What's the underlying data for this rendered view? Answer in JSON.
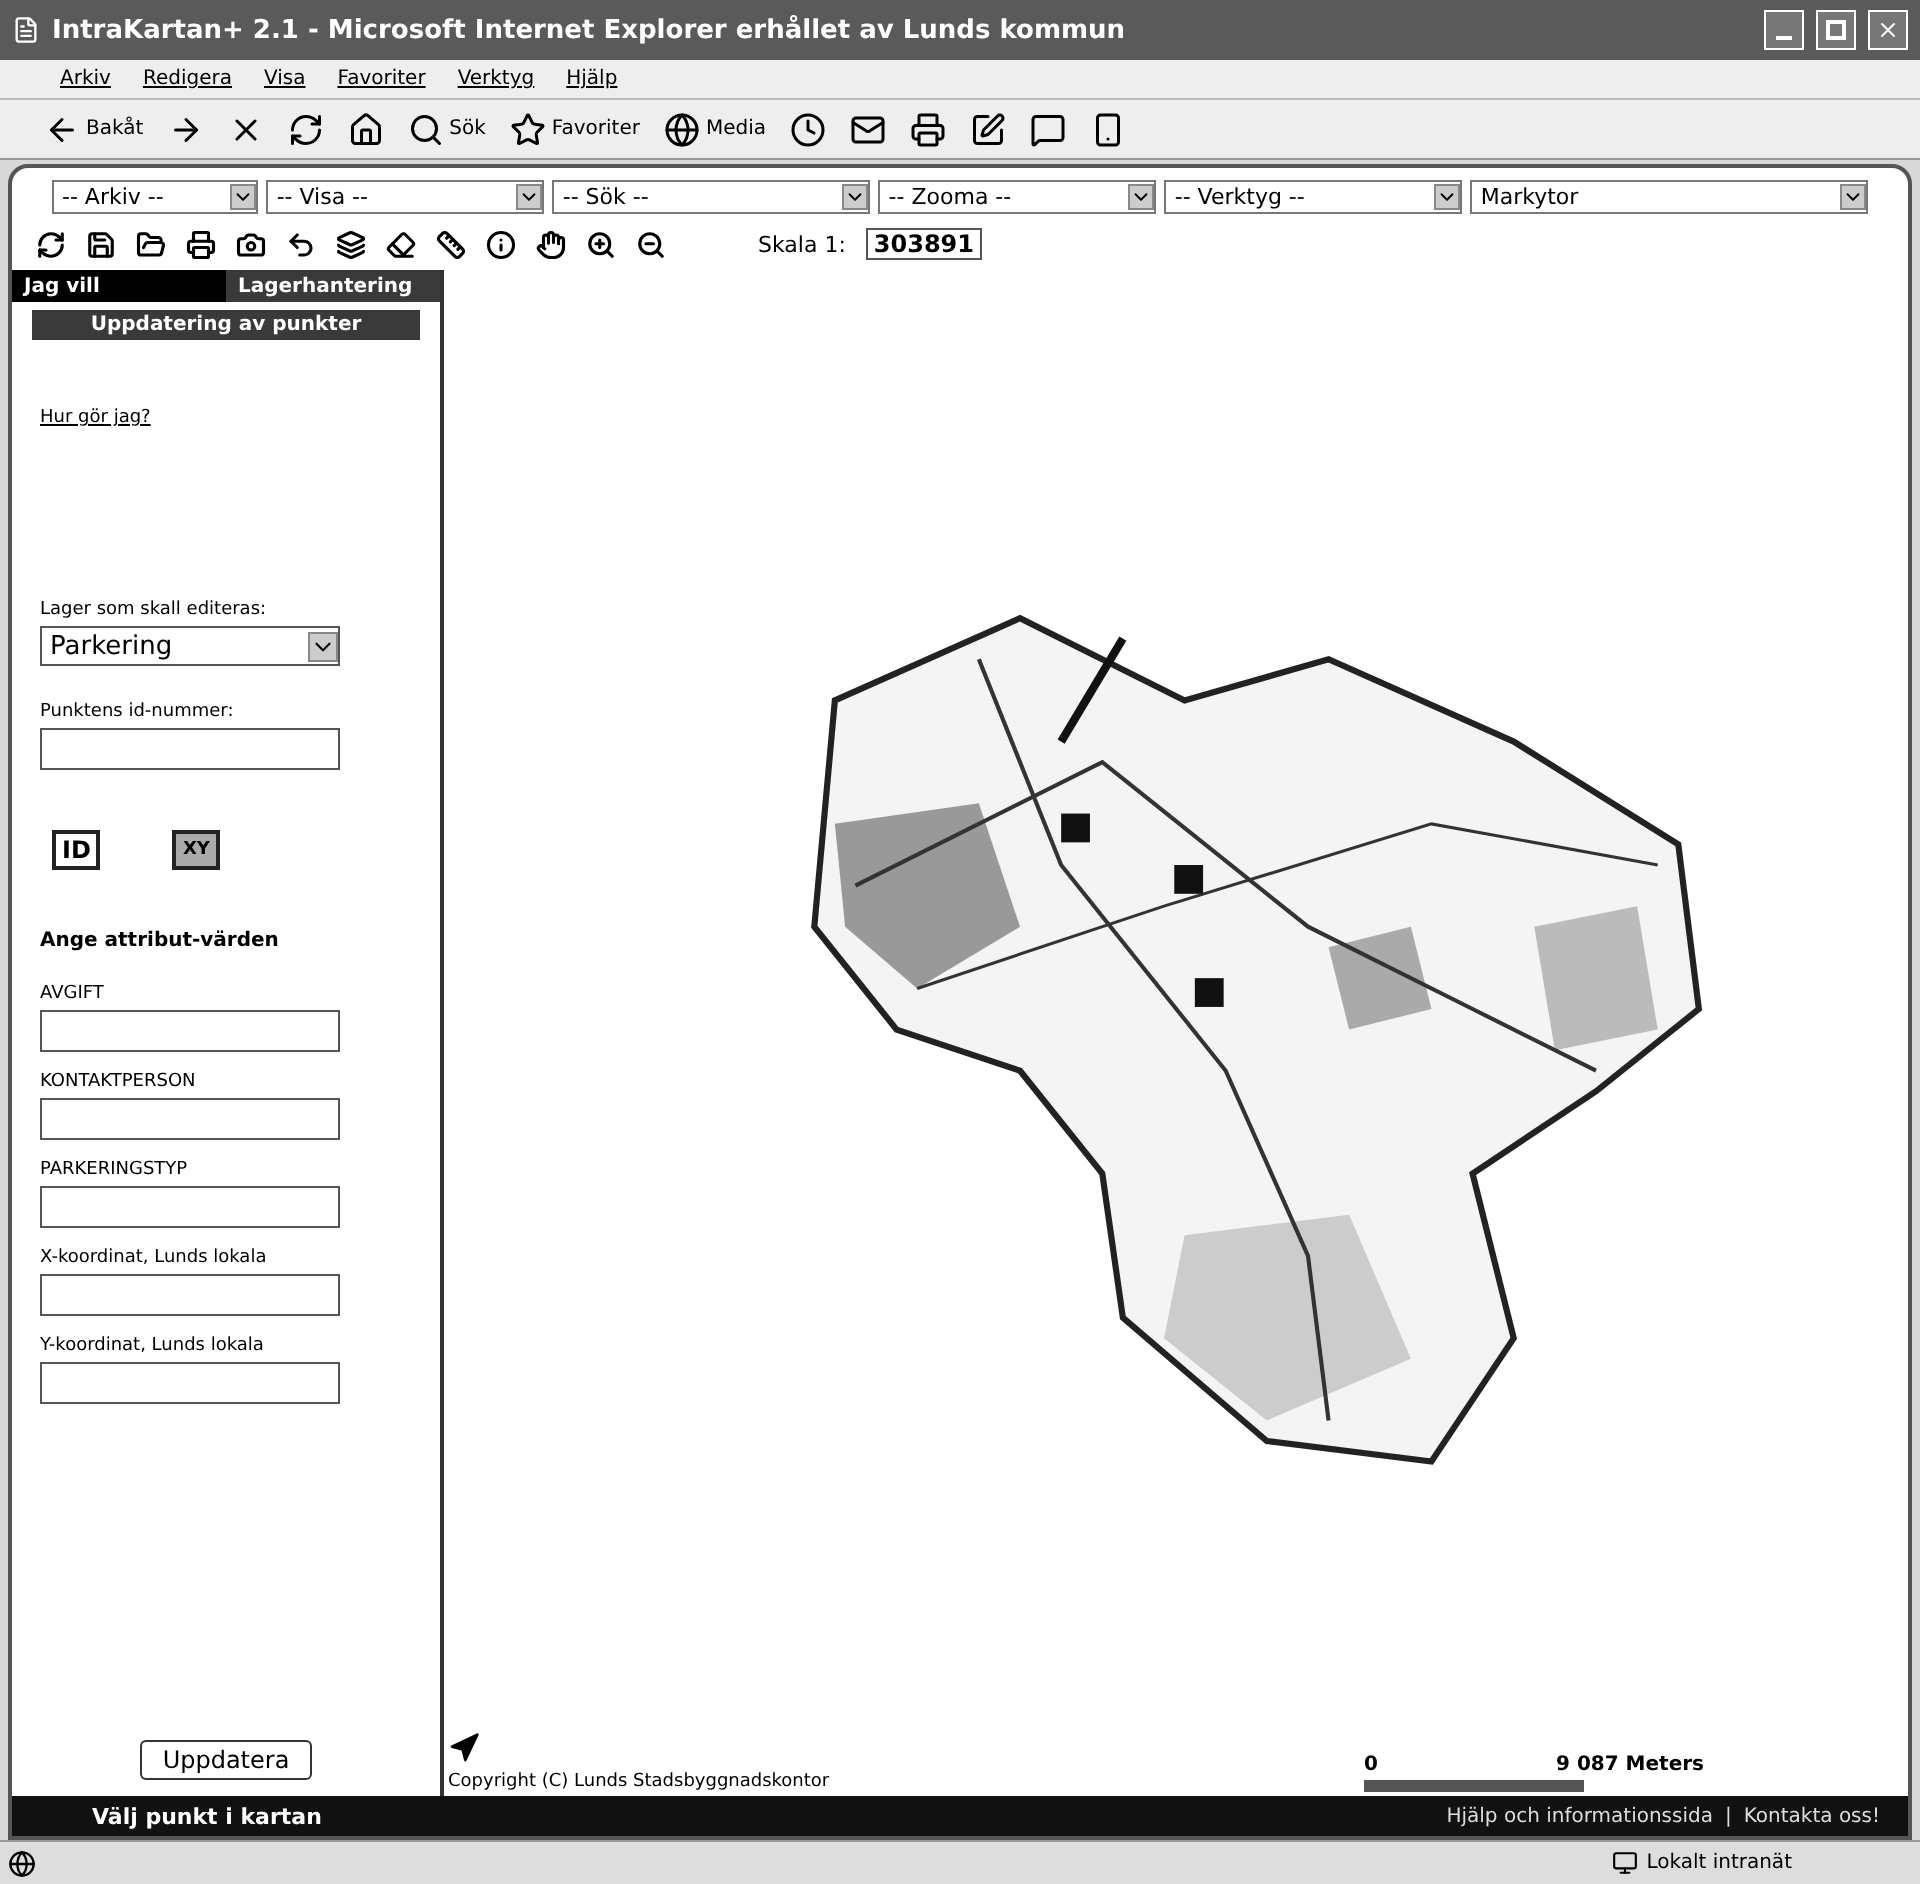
{
  "window": {
    "title": "IntraKartan+ 2.1 - Microsoft Internet Explorer erhållet av Lunds kommun"
  },
  "menu": [
    "Arkiv",
    "Redigera",
    "Visa",
    "Favoriter",
    "Verktyg",
    "Hjälp"
  ],
  "browser_toolbar": [
    {
      "kind": "back",
      "label": "Bakåt"
    },
    {
      "kind": "forward"
    },
    {
      "kind": "stop"
    },
    {
      "kind": "refresh"
    },
    {
      "kind": "home"
    },
    {
      "kind": "search",
      "label": "Sök"
    },
    {
      "kind": "favorites",
      "label": "Favoriter"
    },
    {
      "kind": "media",
      "label": "Media"
    },
    {
      "kind": "history"
    },
    {
      "kind": "mail"
    },
    {
      "kind": "print"
    },
    {
      "kind": "edit"
    },
    {
      "kind": "discuss"
    },
    {
      "kind": "messenger"
    }
  ],
  "app_menus": [
    {
      "value": "-- Arkiv --"
    },
    {
      "value": "-- Visa --"
    },
    {
      "value": "-- Sök --"
    },
    {
      "value": "-- Zooma --"
    },
    {
      "value": "-- Verktyg --"
    },
    {
      "value": "Markytor"
    }
  ],
  "app_tools": [
    {
      "kind": "reload"
    },
    {
      "kind": "save"
    },
    {
      "kind": "open"
    },
    {
      "kind": "print"
    },
    {
      "kind": "camera"
    },
    {
      "kind": "back"
    },
    {
      "kind": "layers"
    },
    {
      "kind": "erase"
    },
    {
      "kind": "measure"
    },
    {
      "kind": "info"
    },
    {
      "kind": "pan"
    },
    {
      "kind": "zoom_in"
    },
    {
      "kind": "zoom_out"
    }
  ],
  "scale": {
    "label": "Skala 1:",
    "value": "303891"
  },
  "tabs": [
    {
      "label": "Jag vill",
      "selected": true
    },
    {
      "label": "Lagerhantering",
      "selected": false
    }
  ],
  "panel": {
    "title": "Uppdatering av punkter",
    "help_link": "Hur gör jag?",
    "layer_label": "Lager som skall editeras:",
    "layer_value": "Parkering",
    "id_label": "Punktens id-nummer:",
    "mode_buttons": [
      "ID",
      "XY"
    ],
    "attributes_heading": "Ange attribut-värden",
    "fields": [
      {
        "label": "AVGIFT"
      },
      {
        "label": "KONTAKTPERSON"
      },
      {
        "label": "PARKERINGSTYP"
      },
      {
        "label": "X-koordinat, Lunds lokala"
      },
      {
        "label": "Y-koordinat, Lunds lokala"
      }
    ],
    "submit": "Uppdatera"
  },
  "map": {
    "kind": "picture",
    "copyright": "Copyright (C) Lunds Stadsbyggnadskontor",
    "scale_start": "0",
    "scale_end": "9 087 Meters"
  },
  "footer": {
    "status": "Välj punkt i kartan",
    "links": [
      "Hjälp och informationssida",
      "Kontakta oss!"
    ],
    "separator": "|"
  },
  "status_bar": {
    "zone": "Lokalt intranät"
  }
}
